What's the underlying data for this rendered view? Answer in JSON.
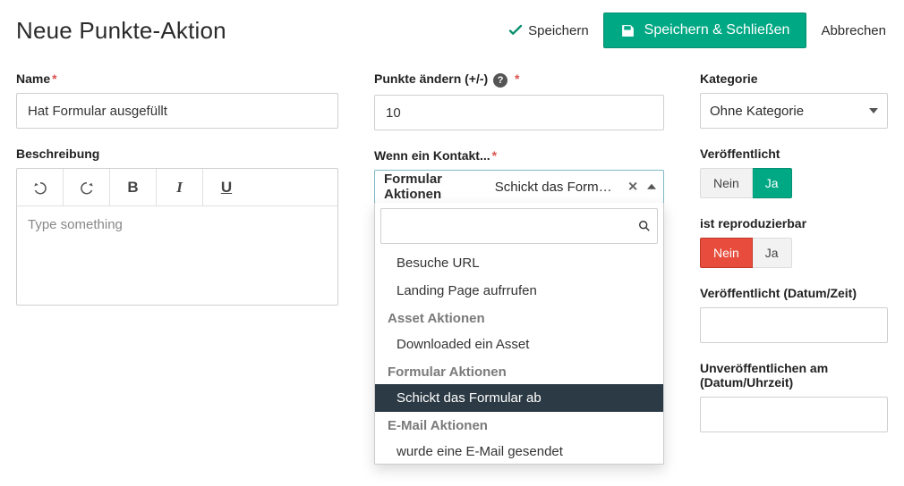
{
  "header": {
    "title": "Neue Punkte-Aktion",
    "save": "Speichern",
    "save_close": "Speichern & Schließen",
    "cancel": "Abbrechen"
  },
  "left": {
    "name_label": "Name",
    "name_value": "Hat Formular ausgefüllt",
    "desc_label": "Beschreibung",
    "editor_placeholder": "Type something"
  },
  "middle": {
    "points_label": "Punkte ändern (+/-)",
    "points_value": "10",
    "trigger_label": "Wenn ein Kontakt...",
    "trigger_selected_group": "Formular Aktionen",
    "trigger_selected_label": "Schickt das Formular ab",
    "trigger_display_truncated": "Schickt das Formular ..",
    "options": [
      {
        "type": "item",
        "label": "Besuche URL"
      },
      {
        "type": "item",
        "label": "Landing Page aufrrufen"
      },
      {
        "type": "group",
        "label": "Asset Aktionen"
      },
      {
        "type": "item",
        "label": "Downloaded ein Asset"
      },
      {
        "type": "group",
        "label": "Formular Aktionen"
      },
      {
        "type": "item",
        "label": "Schickt das Formular ab",
        "selected": true
      },
      {
        "type": "group",
        "label": "E-Mail Aktionen"
      },
      {
        "type": "item",
        "label": "wurde eine E-Mail gesendet"
      }
    ]
  },
  "right": {
    "category_label": "Kategorie",
    "category_value": "Ohne Kategorie",
    "published_label": "Veröffentlicht",
    "no": "Nein",
    "yes": "Ja",
    "published_value": "yes",
    "repeatable_label": "ist reproduzierbar",
    "repeatable_value": "no",
    "publish_at_label": "Veröffentlicht (Datum/Zeit)",
    "publish_at_value": "",
    "unpublish_at_label": "Unveröffentlichen am (Datum/Uhrzeit)",
    "unpublish_at_value": ""
  }
}
